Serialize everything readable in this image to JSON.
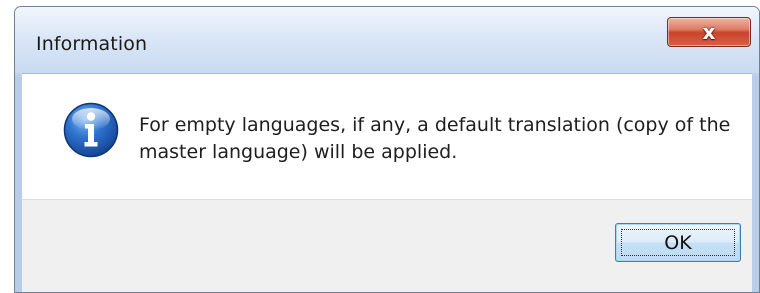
{
  "dialog": {
    "title": "Information",
    "close_glyph": "x",
    "icon": "information-icon",
    "message": "For empty languages, if any, a default translation (copy of the master language) will be applied.",
    "ok_label": "OK"
  },
  "colors": {
    "close_button": "#c8452c",
    "ok_button_border": "#3c7fb1",
    "info_icon": "#1f5fb3"
  }
}
